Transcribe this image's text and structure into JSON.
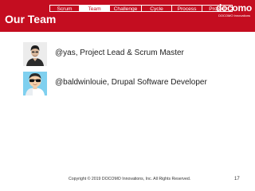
{
  "nav": {
    "items": [
      "Scrum",
      "Team",
      "Challenge",
      "Cycle",
      "Process",
      "Project"
    ],
    "active": "Team"
  },
  "logo": {
    "wordmark": "docomo",
    "tagline": "DOCOMO Innovations"
  },
  "slide": {
    "title": "Our Team",
    "members": [
      {
        "text": "@yas, Project Lead & Scrum Master",
        "avatar": "photo-avatar"
      },
      {
        "text": "@baldwinlouie, Drupal Software Developer",
        "avatar": "cartoon-avatar-sunglasses"
      }
    ]
  },
  "footer": {
    "copyright": "Copyright © 2019 DOCOMO Innovations, Inc.  All Rights Reserved.",
    "page_number": "17"
  },
  "colors": {
    "brand_red": "#c40d20",
    "text": "#222222",
    "background": "#ffffff"
  }
}
